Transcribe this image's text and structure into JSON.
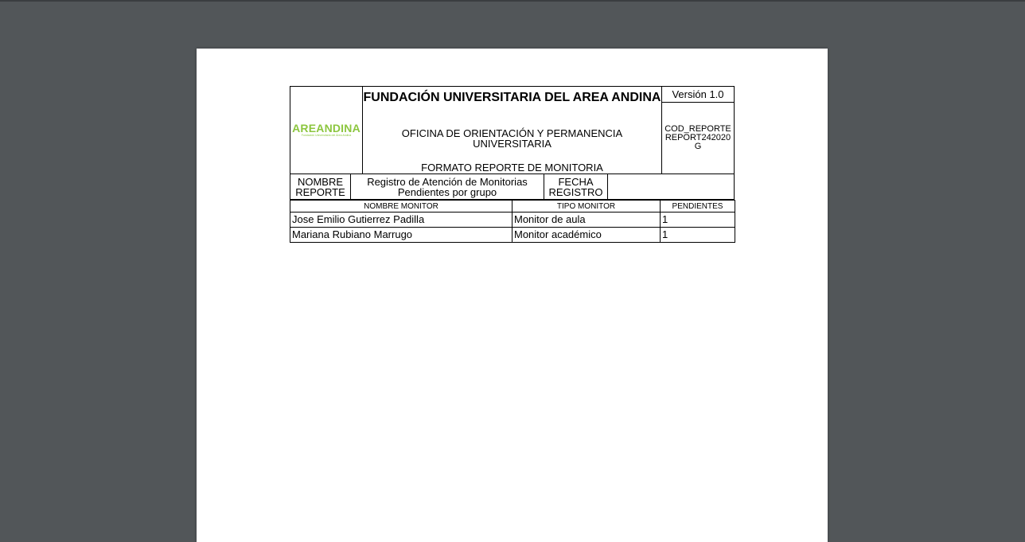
{
  "viewer": {
    "background": "#525659",
    "page_color": "#ffffff"
  },
  "header": {
    "logo_text": "AREANDINA",
    "logo_tagline": "Fundación Universitaria del Área Andina",
    "logo_color": "#8cc63f",
    "institution": "FUNDACIÓN UNIVERSITARIA DEL AREA ANDINA",
    "office": "OFICINA DE ORIENTACIÓN Y PERMANENCIA UNIVERSITARIA",
    "format": "FORMATO REPORTE DE MONITORIA",
    "version": "Versión 1.0",
    "code": "COD_REPORTE REPORT242020G"
  },
  "info": {
    "report_name_label": "NOMBRE REPORTE",
    "report_name_value": "Registro de Atención de Monitorias Pendientes por grupo",
    "date_label": "FECHA REGISTRO",
    "date_value": ""
  },
  "table": {
    "columns": [
      "NOMBRE MONITOR",
      "TIPO MONITOR",
      "PENDIENTES"
    ],
    "rows": [
      [
        "Jose Emilio Gutierrez Padilla",
        "Monitor de aula",
        "1"
      ],
      [
        "Mariana Rubiano Marrugo",
        "Monitor académico",
        "1"
      ]
    ]
  }
}
